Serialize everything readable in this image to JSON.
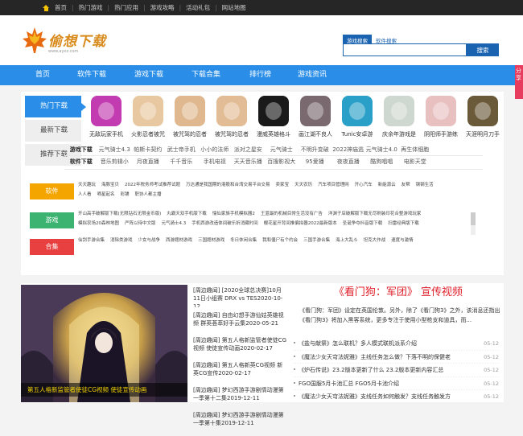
{
  "topbar": {
    "items": [
      "首页",
      "热门游戏",
      "热门应用",
      "游戏攻略",
      "活动礼包",
      "网站地图"
    ]
  },
  "header": {
    "logo_text": "偷想下载",
    "logo_url": "www.ayxz.com",
    "search_tabs": [
      "游戏搜索",
      "软件搜索"
    ],
    "search_button": "搜索",
    "search_value": ""
  },
  "nav": {
    "items": [
      "首页",
      "软件下载",
      "游戏下载",
      "下载合集",
      "排行榜",
      "游戏资讯"
    ]
  },
  "side_float": "分享",
  "ranking": {
    "vtabs": [
      "热门下载",
      "最新下载",
      "推荐下载"
    ],
    "apps": [
      {
        "name": "无敌玩家手机",
        "color": "#c23bb0"
      },
      {
        "name": "火影忍者被咒",
        "color": "#e8c8a0"
      },
      {
        "name": "被咒驾的忍者",
        "color": "#e0b890"
      },
      {
        "name": "被咒驾的忍者",
        "color": "#e2bc94"
      },
      {
        "name": "漫威英雄格斗",
        "color": "#1a1a1a"
      },
      {
        "name": "画江湖不良人",
        "color": "#7a6a70"
      },
      {
        "name": "Tunic安卓游",
        "color": "#2aa0c8"
      },
      {
        "name": "庆余年游戏是",
        "color": "#cfd8d0"
      },
      {
        "name": "阴阳师手游练",
        "color": "#e8c0c0"
      },
      {
        "name": "天涯明月刀手",
        "color": "#6b5a3a"
      }
    ],
    "tag_row1": [
      "游戏下载",
      "元气骑士4.3",
      "帕斯卡契约",
      "武士帝手机",
      "小小的法师",
      "派对之星安",
      "元气骑士",
      "不明升变破",
      "2022神庙逃",
      "元气骑士4.0",
      "再生体细胞"
    ],
    "tag_row2": [
      "软件下载",
      "音乐剪辑小",
      "月夜直播",
      "千千音乐",
      "手机电视",
      "天天音乐播",
      "百搜影视大",
      "95爱播",
      "夜夜直播",
      "酷狗唱唱",
      "电影天堂"
    ]
  },
  "categories": [
    {
      "label": "软件",
      "color": "#f5a500",
      "lines": [
        [
          "天天趣玩",
          "海豚宝贝",
          "2022年税务师考试推荐试题",
          "万达通是我国期的港股和台湾交易平台交易",
          "卖家宝",
          "天天农历",
          "汽车项目管理网",
          "开心汽车",
          "新能源云",
          "友帮",
          "钢钢生活"
        ],
        [
          "人人看",
          "嘀星起名",
          "彩铺",
          "职协人都主播"
        ]
      ]
    },
    {
      "label": "游戏",
      "color": "#3cb371",
      "lines": [
        [
          "开山高手破解版下载(无限钻石无限金币版)",
          "丸霸天双手机版下载",
          "懦仙家族手机模拟器2",
          "王蓝最的机械目常生活没有广告",
          "洋渊子店破解版下载无尽刷装印花合整游戏玩家"
        ],
        [
          "模拟农场20森林地图",
          "严阵以待中文版",
          "元气骑士4.3",
          "手机西游改造体间破乐折消藏时间",
          "樱花星开背间推偏拟器2022最新版本",
          "圣诞争夺抖音版下载",
          "扫雷经典版下载"
        ]
      ]
    },
    {
      "label": "合集",
      "color": "#e84040",
      "lines": [
        [
          "仙剑手游合集",
          "消除类游戏",
          "少女与战争",
          "西游题材游戏",
          "三国题材游戏",
          "冬日休闲合集",
          "我和僵尸有个约会",
          "三国手游合集",
          "海上大乱斗",
          "坦克大作战",
          "速度与激情"
        ]
      ]
    }
  ],
  "hero": {
    "caption": "第五人格新监管者使徒CG视频 使徒宣传动画"
  },
  "news": [
    "[周边趣闻] [2020全球总决赛]10月11日小组赛 DRX vs TES2020-10-12",
    "[周边趣闻] 自由幻想手游仙姑英雄视频 群英荟萃好手云集2020-05-21",
    "[周边趣闻] 第五人格新监管者使徒CG视频 使徒宣传动画2020-02-17",
    "[周边趣闻] 第五人格新英CG视频 新英CG宣传2020-02-17",
    "[周边趣闻] 梦幻西游手游剧情动漫第一季第十二集2019-12-11",
    "[周边趣闻] 梦幻西游手游剧情动漫第一季第十集2019-12-11"
  ],
  "feature": {
    "title": "《看门狗：军团》 宣传视频",
    "desc": "《看门狗：军团》设定在英国伦敦。另外，除了《看门狗3》之外，该消息还指出《看门狗3》将加入黑客系统，更多专注于使用小型枪支和道具，而..."
  },
  "feature_list": [
    {
      "title": "《盐与献祭》怎么联机？多人模式联机派系介绍",
      "date": "05-12"
    },
    {
      "title": "《魔法少女天穹法妮雅》主线任务怎么做？下落不明的保健老",
      "date": "05-12"
    },
    {
      "title": "《炉石传说》23.2版本更新了什么 23.2版本更新内容汇总",
      "date": "05-12"
    },
    {
      "title": "FGO国服5月卡池汇总 FGO5月卡池介绍",
      "date": "05-12"
    },
    {
      "title": "《魔法少女天穹法妮雅》支线任务如何触发？支线任务触发方",
      "date": "05-12"
    }
  ]
}
